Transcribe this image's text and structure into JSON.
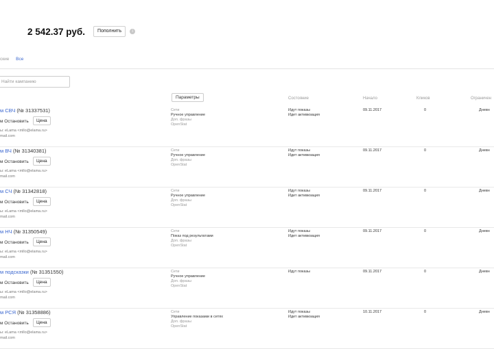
{
  "balance": {
    "amount": "2 542.37 руб.",
    "topup_label": "Пополнить",
    "info_icon": "info-icon"
  },
  "filters": {
    "partial": "ские",
    "all": "Все"
  },
  "search": {
    "placeholder": "Найти кампанию"
  },
  "params_label": "Параметры",
  "columns": {
    "state": "Состояние",
    "start": "Начало",
    "clicks": "Кликов",
    "limit": "Ограничен"
  },
  "campaigns": [
    {
      "title": "м СВЧ",
      "number": "(№ 31337531)",
      "stop": "м  Остановить",
      "price": "Цена",
      "email": "ы: eLama <mllo@elama.ru>",
      "email2": "mail.com",
      "net": "Сети",
      "strategy": "Ручное управление",
      "extra": "Доп. фразы",
      "openstat": "OpenStat",
      "state1": "Идут показы",
      "state2": "Идет активизация",
      "date": "09.11.2017",
      "clicks": "0",
      "limit": "Дневн"
    },
    {
      "title": "м ВЧ",
      "number": "(№ 31340381)",
      "stop": "м  Остановить",
      "price": "Цена",
      "email": "ы: eLama <mllo@elama.ru>",
      "email2": "mail.com",
      "net": "Сети",
      "strategy": "Ручное управление",
      "extra": "Доп. фразы",
      "openstat": "OpenStat",
      "state1": "Идут показы",
      "state2": "Идет активизация",
      "date": "09.11.2017",
      "clicks": "0",
      "limit": "Дневн"
    },
    {
      "title": "м СЧ",
      "number": "(№ 31342818)",
      "stop": "м  Остановить",
      "price": "Цена",
      "email": "ы: eLama <mllo@elama.ru>",
      "email2": "mail.com",
      "net": "Сети",
      "strategy": "Ручное управление",
      "extra": "Доп. фразы",
      "openstat": "OpenStat",
      "state1": "Идут показы",
      "state2": "Идет активизация",
      "date": "09.11.2017",
      "clicks": "0",
      "limit": "Дневн"
    },
    {
      "title": "м НЧ",
      "number": "(№ 31350549)",
      "stop": "м  Остановить",
      "price": "Цена",
      "email": "ы: eLama <mllo@elama.ru>",
      "email2": "mail.com",
      "net": "Сети",
      "strategy": "Показ под результатами",
      "extra": "Доп. фразы",
      "openstat": "OpenStat",
      "state1": "Идут показы",
      "state2": "Идет активизация",
      "date": "09.11.2017",
      "clicks": "0",
      "limit": "Дневн"
    },
    {
      "title": "м подсказки",
      "number": "(№ 31351550)",
      "stop": "м  Остановить",
      "price": "Цена",
      "email": "ы: eLama <mllo@elama.ru>",
      "email2": "mail.com",
      "net": "Сети",
      "strategy": "Ручное управление",
      "extra": "Доп. фразы",
      "openstat": "OpenStat",
      "state1": "Идут показы",
      "state2": "",
      "date": "09.11.2017",
      "clicks": "0",
      "limit": "Дневн"
    },
    {
      "title": "м РСЯ",
      "number": "(№ 31358886)",
      "stop": "м  Остановить",
      "price": "Цена",
      "email": "ы: eLama <mllo@elama.ru>",
      "email2": "mail.com",
      "net": "Сети",
      "strategy": "Управление показами в сетях",
      "extra": "Доп. фразы",
      "openstat": "OpenStat",
      "state1": "Идут показы",
      "state2": "Идет активизация",
      "date": "10.11.2017",
      "clicks": "0",
      "limit": "Дневн"
    }
  ]
}
